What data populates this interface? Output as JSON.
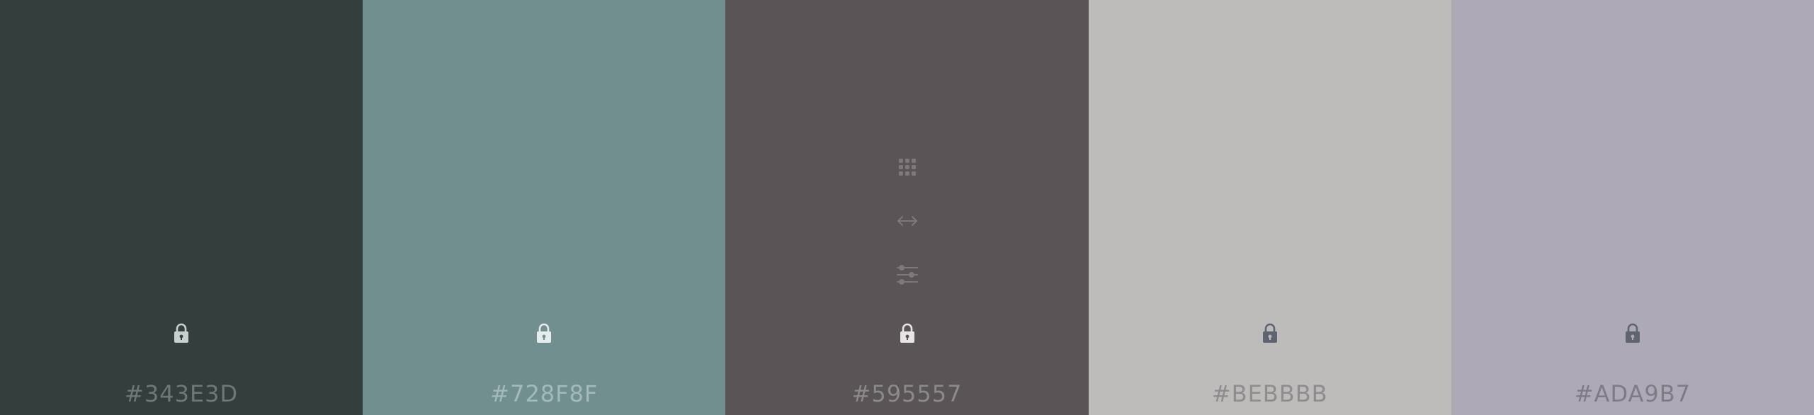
{
  "palette": {
    "swatches": [
      {
        "hex": "#343E3D",
        "color": "#343E3D",
        "label_color": "#6F7877",
        "lock_color": "#C9CFCE",
        "locked": false
      },
      {
        "hex": "#728F8F",
        "color": "#728F8F",
        "label_color": "#A4B9B9",
        "lock_color": "#E4ECEC",
        "locked": false
      },
      {
        "hex": "#595557",
        "color": "#595557",
        "label_color": "#8C898A",
        "lock_color": "#E6E4E5",
        "locked": false
      },
      {
        "hex": "#BEBBBB",
        "color": "#BEBBBB",
        "label_color": "#8E8C8D",
        "lock_color": "#5F6470",
        "locked": false
      },
      {
        "hex": "#ADA9B7",
        "color": "#ADA9B7",
        "label_color": "#7E7B87",
        "lock_color": "#5F6470",
        "locked": false
      }
    ],
    "hovered_swatch_tools": [
      "drag-grid-icon",
      "resize-arrows-icon",
      "adjust-sliders-icon"
    ],
    "tool_icon_color": "#7D797B"
  }
}
